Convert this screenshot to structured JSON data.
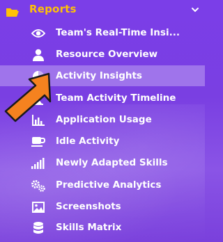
{
  "section": {
    "title": "Reports",
    "folder_icon": "folder-open-icon",
    "toggle_icon": "chevron-down-icon"
  },
  "menu": [
    {
      "label": "Team's Real-Time Insi...",
      "icon": "eye-icon"
    },
    {
      "label": "Resource Overview",
      "icon": "user-icon"
    },
    {
      "label": "Activity Insights",
      "icon": "pie-chart-icon",
      "active": true
    },
    {
      "label": "Team Activity Timeline",
      "icon": "hourglass-icon"
    },
    {
      "label": "Application Usage",
      "icon": "bar-chart-icon"
    },
    {
      "label": "Idle Activity",
      "icon": "coffee-cup-icon"
    },
    {
      "label": "Newly Adapted Skills",
      "icon": "signal-bars-icon"
    },
    {
      "label": "Predictive Analytics",
      "icon": "gears-icon"
    },
    {
      "label": "Screenshots",
      "icon": "image-icon"
    },
    {
      "label": "Skills Matrix",
      "icon": "database-icon"
    }
  ],
  "colors": {
    "accent": "#ffc107",
    "pointer": "#f5821f",
    "background": "#7b3ee8"
  }
}
